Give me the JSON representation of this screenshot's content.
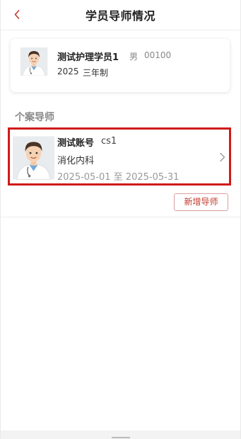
{
  "header": {
    "title": "学员导师情况",
    "back_icon": "chevron-left-icon"
  },
  "student": {
    "name": "测试护理学员1",
    "gender": "男",
    "id": "00100",
    "year": "2025",
    "program": "三年制",
    "avatar_icon": "doctor-avatar-icon"
  },
  "section": {
    "title": "个案导师"
  },
  "mentor": {
    "name": "测试账号",
    "code": "cs1",
    "department": "消化内科",
    "dates": "2025-05-01 至 2025-05-31",
    "avatar_icon": "doctor-avatar-icon"
  },
  "actions": {
    "add_mentor_label": "新增导师"
  },
  "colors": {
    "accent": "#c0392b",
    "highlight_border": "#d11a1a"
  }
}
